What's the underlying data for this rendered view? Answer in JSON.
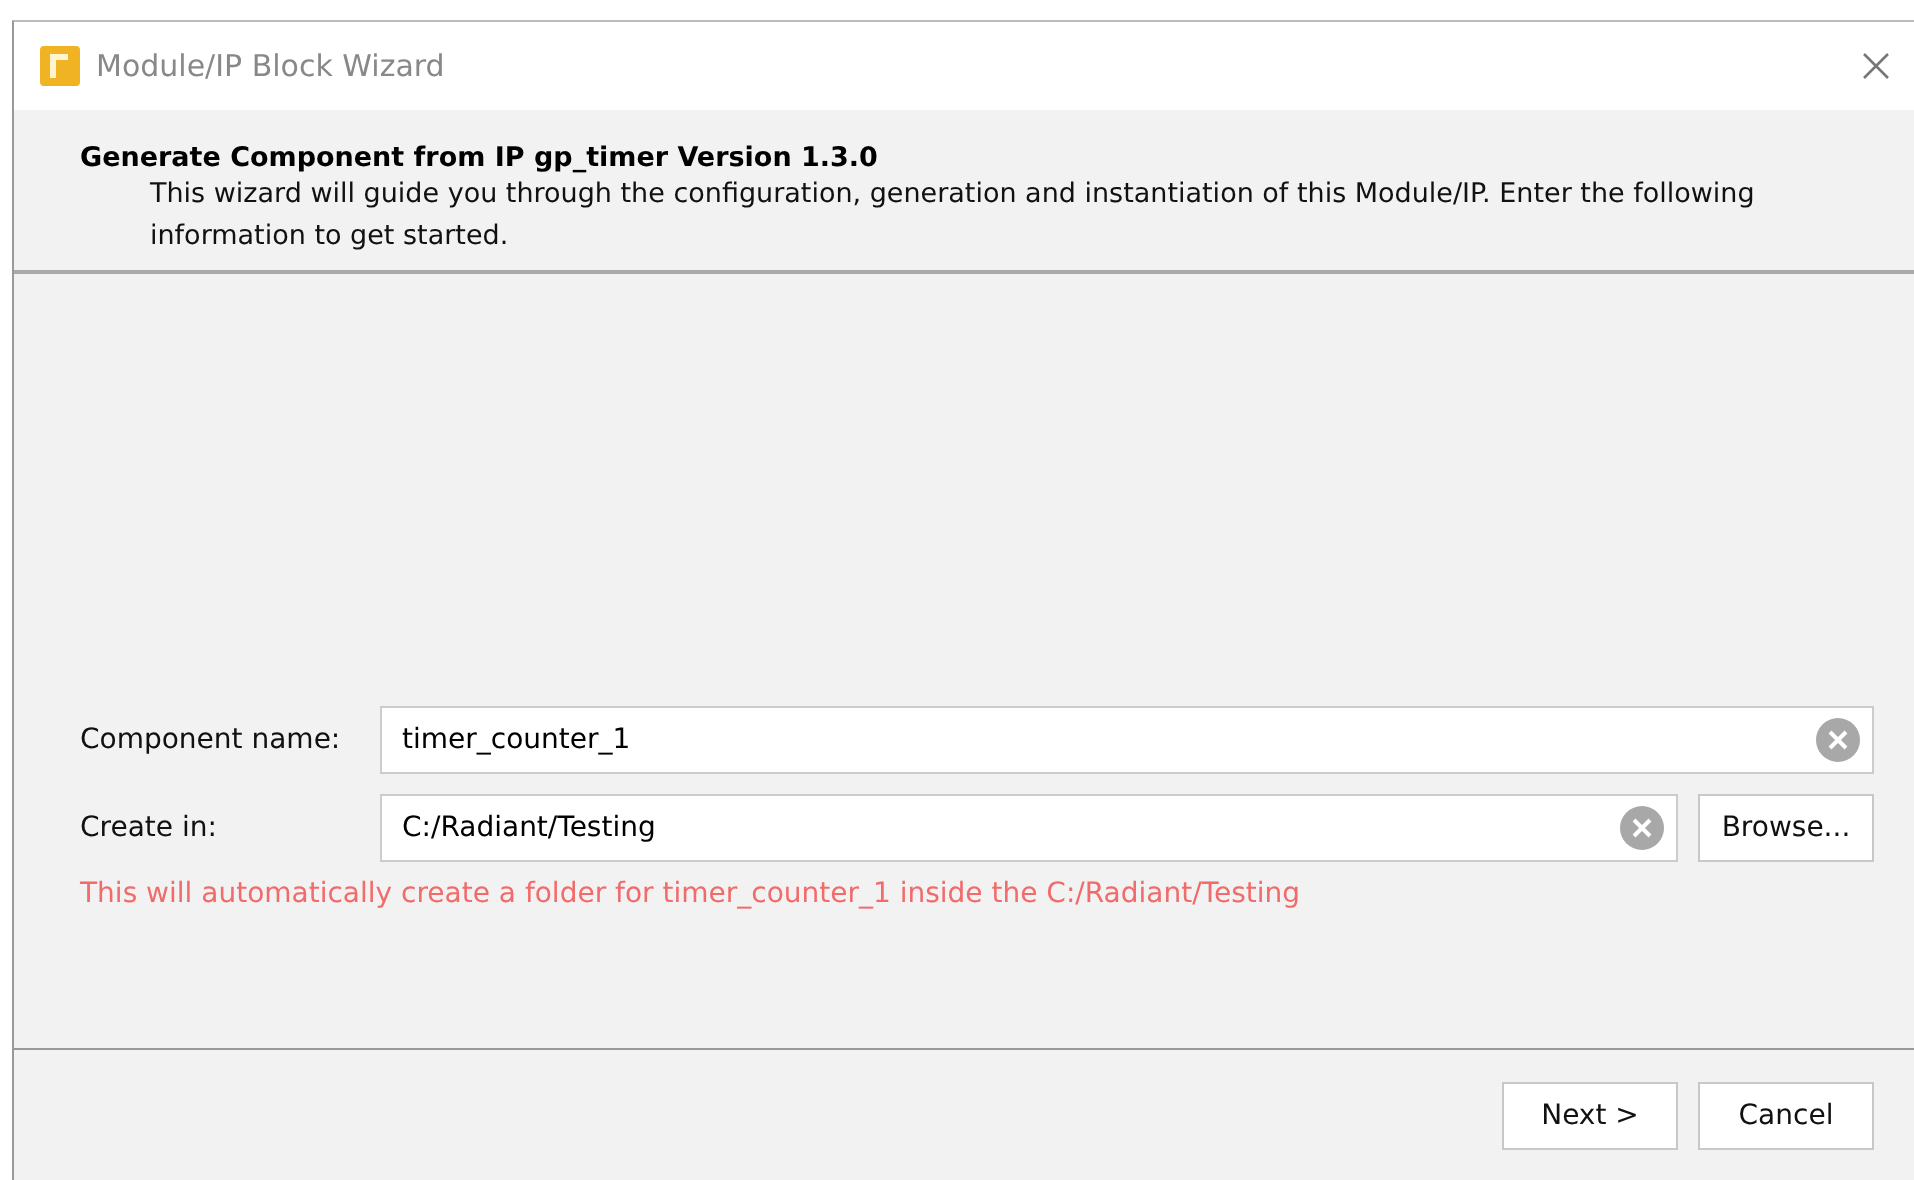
{
  "window": {
    "title": "Module/IP Block Wizard"
  },
  "header": {
    "title": "Generate Component from IP gp_timer Version 1.3.0",
    "description": "This wizard will guide you through the configuration, generation and instantiation of this Module/IP. Enter the following information to get started."
  },
  "fields": [
    {
      "label": "Component name:",
      "value": "timer_counter_1",
      "kind": "text"
    },
    {
      "label": "Create in:",
      "value": "C:/Radiant/Testing",
      "kind": "folder",
      "button": "Browse..."
    }
  ],
  "message": "This will automatically create a folder for timer_counter_1 inside the C:/Radiant/Testing",
  "buttons": [
    "Next >",
    "Cancel"
  ]
}
